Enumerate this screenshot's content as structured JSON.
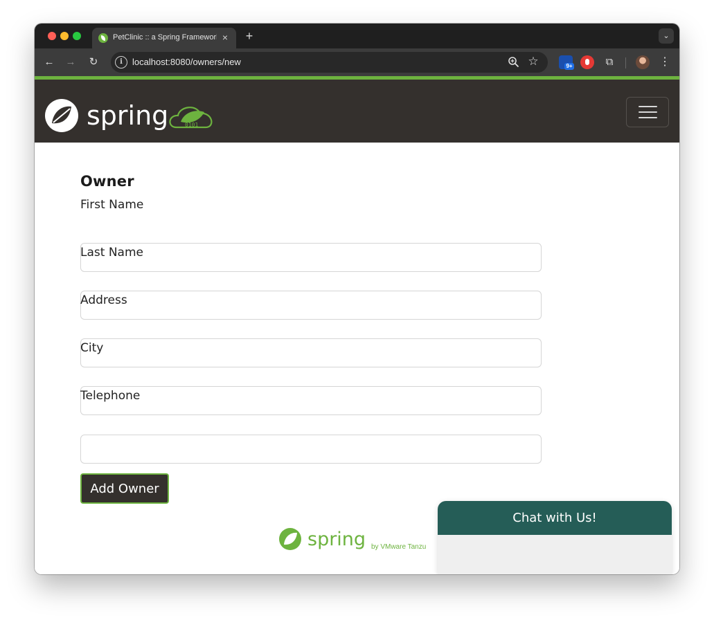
{
  "browser": {
    "tab_title": "PetClinic :: a Spring Framework",
    "tab_close": "×",
    "new_tab": "+",
    "tab_search": "⌄",
    "url": "localhost:8080/owners/new",
    "site_info": "i",
    "extension_badge": "9+",
    "back": "←",
    "forward": "→",
    "reload": "↻",
    "star": "☆",
    "extensions_puzzle": "⧉",
    "menu": "⋮"
  },
  "navbar": {
    "brand_text": "spring",
    "accent_color": "#6db33f",
    "background_color": "#34302d"
  },
  "form": {
    "heading": "Owner",
    "fields": [
      {
        "label": "First Name",
        "value": ""
      },
      {
        "label": "Last Name",
        "value": ""
      },
      {
        "label": "Address",
        "value": ""
      },
      {
        "label": "City",
        "value": ""
      },
      {
        "label": "Telephone",
        "value": ""
      }
    ],
    "submit_label": "Add Owner"
  },
  "footer": {
    "brand_text": "spring",
    "byline": "by VMware Tanzu"
  },
  "chat": {
    "title": "Chat with Us!",
    "header_color": "#255d57"
  }
}
